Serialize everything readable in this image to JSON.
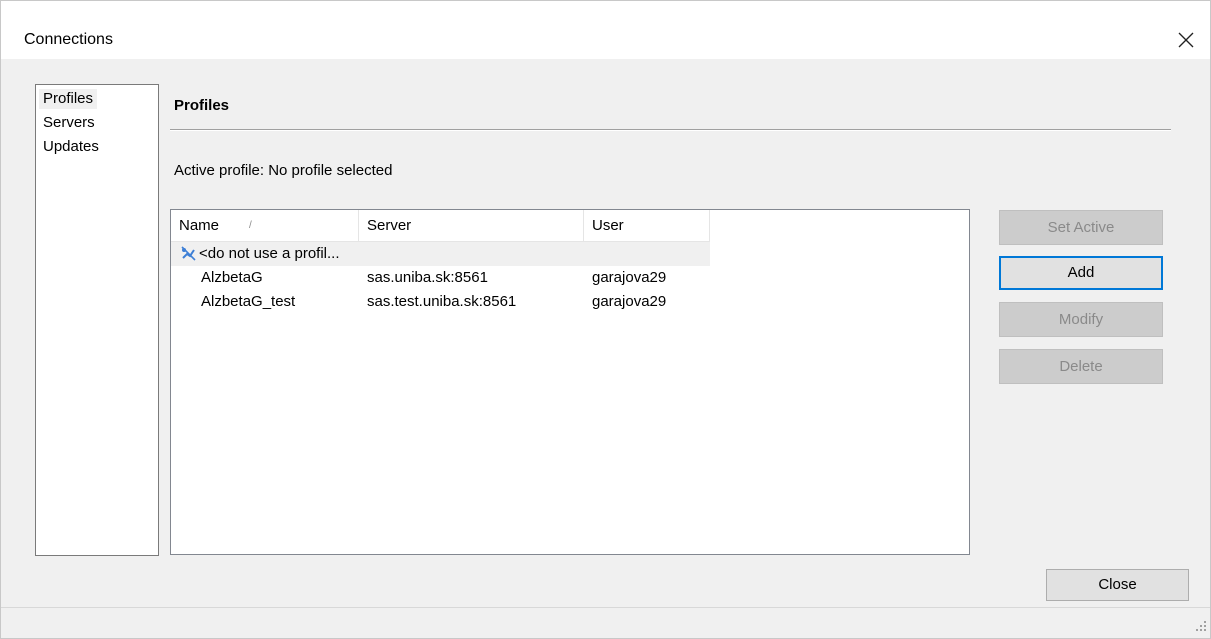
{
  "window": {
    "title": "Connections",
    "close_icon": "close-icon"
  },
  "nav": {
    "items": [
      {
        "label": "Profiles",
        "selected": true
      },
      {
        "label": "Servers",
        "selected": false
      },
      {
        "label": "Updates",
        "selected": false
      }
    ]
  },
  "profiles": {
    "section_title": "Profiles",
    "active_profile_text": "Active profile: No profile selected",
    "columns": [
      {
        "label": "Name",
        "sorted": "ascending"
      },
      {
        "label": "Server"
      },
      {
        "label": "User"
      }
    ],
    "sort_indicator_glyph": "/",
    "rows": [
      {
        "name": "<do not use a profil...",
        "server": "",
        "user": "",
        "icon": "no-profile-icon",
        "highlighted": true
      },
      {
        "name": "AlzbetaG",
        "server": "sas.uniba.sk:8561",
        "user": "garajova29"
      },
      {
        "name": "AlzbetaG_test",
        "server": "sas.test.uniba.sk:8561",
        "user": "garajova29"
      }
    ]
  },
  "buttons": {
    "set_active": {
      "label": "Set Active",
      "enabled": false
    },
    "add": {
      "label": "Add",
      "enabled": true,
      "default": true
    },
    "modify": {
      "label": "Modify",
      "enabled": false
    },
    "delete": {
      "label": "Delete",
      "enabled": false
    },
    "close": {
      "label": "Close",
      "enabled": true
    }
  },
  "colors": {
    "window_bg": "#f0f0f0",
    "accent": "#0078d7",
    "disabled_button": "#cccccc",
    "icon_blue": "#3d7fd6"
  }
}
